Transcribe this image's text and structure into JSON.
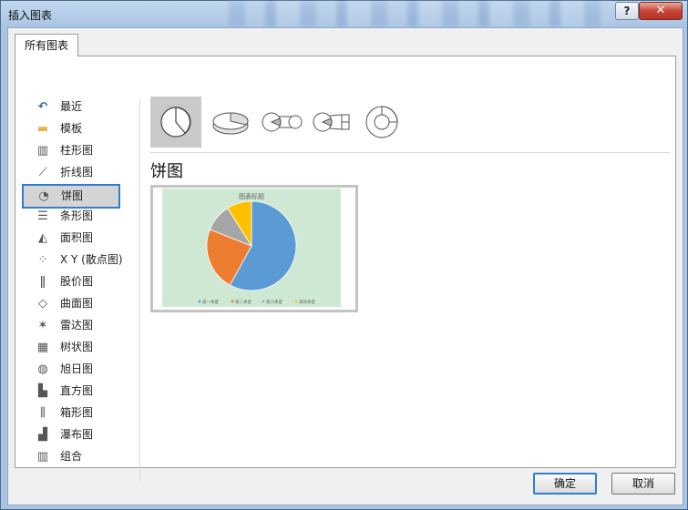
{
  "window": {
    "title": "插入图表",
    "help": "?",
    "close": "✕"
  },
  "tab": {
    "label": "所有图表"
  },
  "sidebar": {
    "items": [
      {
        "label": "最近",
        "icon": "recent-icon",
        "glyph": "↶"
      },
      {
        "label": "模板",
        "icon": "folder-icon",
        "glyph": "▬"
      },
      {
        "label": "柱形图",
        "icon": "column-chart-icon",
        "glyph": "▥"
      },
      {
        "label": "折线图",
        "icon": "line-chart-icon",
        "glyph": "⟋"
      },
      {
        "label": "饼图",
        "icon": "pie-chart-icon",
        "glyph": "◔"
      },
      {
        "label": "条形图",
        "icon": "bar-chart-icon",
        "glyph": "☰"
      },
      {
        "label": "面积图",
        "icon": "area-chart-icon",
        "glyph": "◭"
      },
      {
        "label": "X Y (散点图)",
        "icon": "scatter-chart-icon",
        "glyph": "⁘"
      },
      {
        "label": "股价图",
        "icon": "stock-chart-icon",
        "glyph": "ǁ"
      },
      {
        "label": "曲面图",
        "icon": "surface-chart-icon",
        "glyph": "◇"
      },
      {
        "label": "雷达图",
        "icon": "radar-chart-icon",
        "glyph": "✶"
      },
      {
        "label": "树状图",
        "icon": "treemap-chart-icon",
        "glyph": "▦"
      },
      {
        "label": "旭日图",
        "icon": "sunburst-chart-icon",
        "glyph": "◍"
      },
      {
        "label": "直方图",
        "icon": "histogram-chart-icon",
        "glyph": "▙"
      },
      {
        "label": "箱形图",
        "icon": "box-whisker-chart-icon",
        "glyph": "⫼"
      },
      {
        "label": "瀑布图",
        "icon": "waterfall-chart-icon",
        "glyph": "▟"
      },
      {
        "label": "组合",
        "icon": "combo-chart-icon",
        "glyph": "▥"
      }
    ],
    "selected_index": 4
  },
  "chart_types": [
    "pie-icon",
    "3d-pie-icon",
    "pie-of-pie-icon",
    "bar-of-pie-icon",
    "doughnut-icon"
  ],
  "section_title": "饼图",
  "preview": {
    "chart_title": "图表标题",
    "legend": [
      "第一季度",
      "第二季度",
      "第三季度",
      "第四季度"
    ]
  },
  "chart_data": {
    "type": "pie",
    "title": "图表标题",
    "categories": [
      "第一季度",
      "第二季度",
      "第三季度",
      "第四季度"
    ],
    "values": [
      58,
      23,
      10,
      9
    ],
    "colors": [
      "#5b9bd5",
      "#ed7d31",
      "#a5a5a5",
      "#ffc000"
    ]
  },
  "buttons": {
    "ok": "确定",
    "cancel": "取消"
  }
}
